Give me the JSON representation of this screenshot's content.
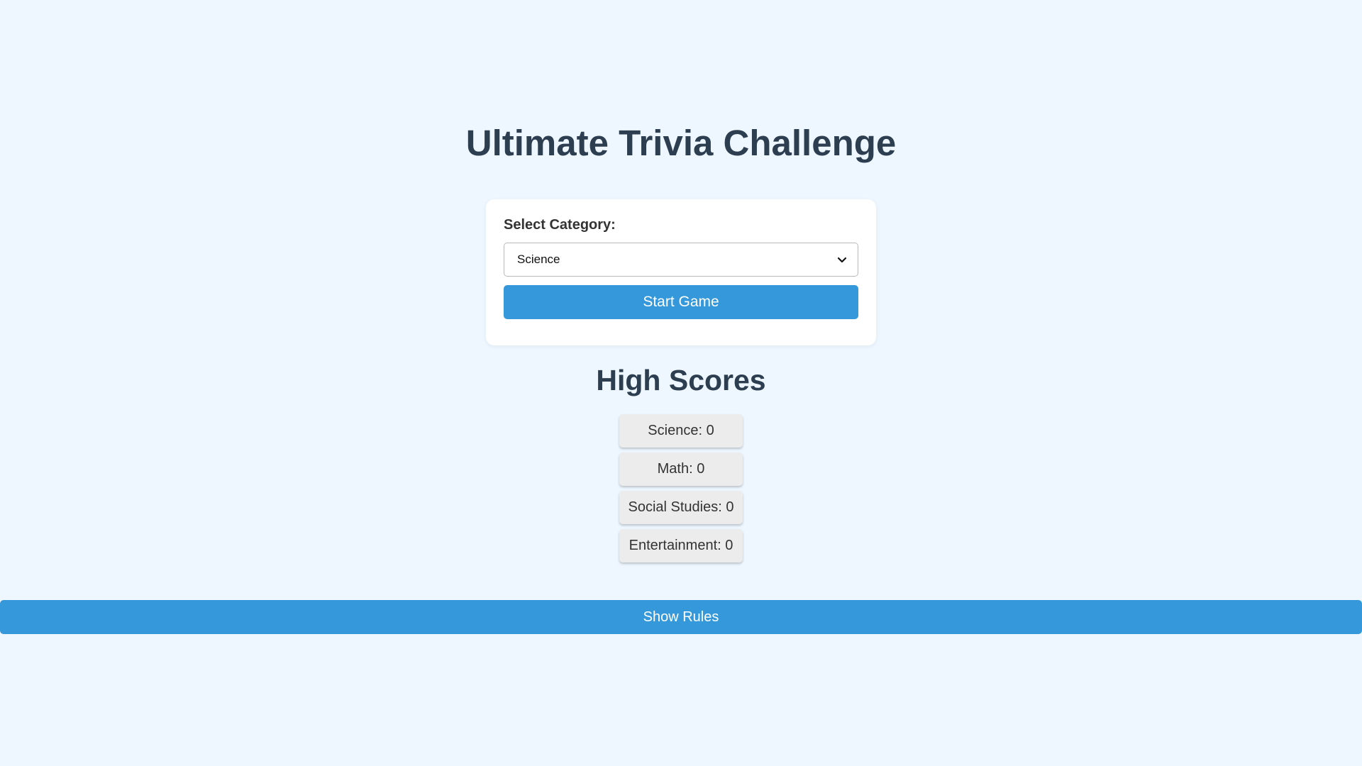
{
  "title": "Ultimate Trivia Challenge",
  "category_form": {
    "label": "Select Category:",
    "selected": "Science",
    "start_label": "Start Game"
  },
  "high_scores": {
    "title": "High Scores",
    "items": [
      "Science: 0",
      "Math: 0",
      "Social Studies: 0",
      "Entertainment: 0"
    ]
  },
  "rules_label": "Show Rules",
  "colors": {
    "background": "#eef7ff",
    "accent": "#3498db",
    "heading": "#2c3e50"
  },
  "icons": {
    "select_chevron": "chevron-down-icon"
  }
}
